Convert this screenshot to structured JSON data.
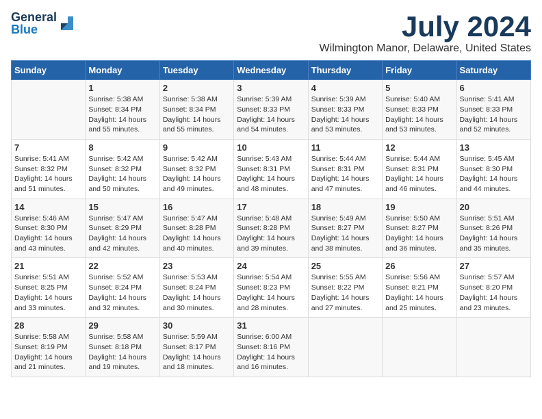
{
  "header": {
    "logo_general": "General",
    "logo_blue": "Blue",
    "month_year": "July 2024",
    "location": "Wilmington Manor, Delaware, United States"
  },
  "days_of_week": [
    "Sunday",
    "Monday",
    "Tuesday",
    "Wednesday",
    "Thursday",
    "Friday",
    "Saturday"
  ],
  "weeks": [
    [
      {
        "day": "",
        "content": ""
      },
      {
        "day": "1",
        "content": "Sunrise: 5:38 AM\nSunset: 8:34 PM\nDaylight: 14 hours\nand 55 minutes."
      },
      {
        "day": "2",
        "content": "Sunrise: 5:38 AM\nSunset: 8:34 PM\nDaylight: 14 hours\nand 55 minutes."
      },
      {
        "day": "3",
        "content": "Sunrise: 5:39 AM\nSunset: 8:33 PM\nDaylight: 14 hours\nand 54 minutes."
      },
      {
        "day": "4",
        "content": "Sunrise: 5:39 AM\nSunset: 8:33 PM\nDaylight: 14 hours\nand 53 minutes."
      },
      {
        "day": "5",
        "content": "Sunrise: 5:40 AM\nSunset: 8:33 PM\nDaylight: 14 hours\nand 53 minutes."
      },
      {
        "day": "6",
        "content": "Sunrise: 5:41 AM\nSunset: 8:33 PM\nDaylight: 14 hours\nand 52 minutes."
      }
    ],
    [
      {
        "day": "7",
        "content": "Sunrise: 5:41 AM\nSunset: 8:32 PM\nDaylight: 14 hours\nand 51 minutes."
      },
      {
        "day": "8",
        "content": "Sunrise: 5:42 AM\nSunset: 8:32 PM\nDaylight: 14 hours\nand 50 minutes."
      },
      {
        "day": "9",
        "content": "Sunrise: 5:42 AM\nSunset: 8:32 PM\nDaylight: 14 hours\nand 49 minutes."
      },
      {
        "day": "10",
        "content": "Sunrise: 5:43 AM\nSunset: 8:31 PM\nDaylight: 14 hours\nand 48 minutes."
      },
      {
        "day": "11",
        "content": "Sunrise: 5:44 AM\nSunset: 8:31 PM\nDaylight: 14 hours\nand 47 minutes."
      },
      {
        "day": "12",
        "content": "Sunrise: 5:44 AM\nSunset: 8:31 PM\nDaylight: 14 hours\nand 46 minutes."
      },
      {
        "day": "13",
        "content": "Sunrise: 5:45 AM\nSunset: 8:30 PM\nDaylight: 14 hours\nand 44 minutes."
      }
    ],
    [
      {
        "day": "14",
        "content": "Sunrise: 5:46 AM\nSunset: 8:30 PM\nDaylight: 14 hours\nand 43 minutes."
      },
      {
        "day": "15",
        "content": "Sunrise: 5:47 AM\nSunset: 8:29 PM\nDaylight: 14 hours\nand 42 minutes."
      },
      {
        "day": "16",
        "content": "Sunrise: 5:47 AM\nSunset: 8:28 PM\nDaylight: 14 hours\nand 40 minutes."
      },
      {
        "day": "17",
        "content": "Sunrise: 5:48 AM\nSunset: 8:28 PM\nDaylight: 14 hours\nand 39 minutes."
      },
      {
        "day": "18",
        "content": "Sunrise: 5:49 AM\nSunset: 8:27 PM\nDaylight: 14 hours\nand 38 minutes."
      },
      {
        "day": "19",
        "content": "Sunrise: 5:50 AM\nSunset: 8:27 PM\nDaylight: 14 hours\nand 36 minutes."
      },
      {
        "day": "20",
        "content": "Sunrise: 5:51 AM\nSunset: 8:26 PM\nDaylight: 14 hours\nand 35 minutes."
      }
    ],
    [
      {
        "day": "21",
        "content": "Sunrise: 5:51 AM\nSunset: 8:25 PM\nDaylight: 14 hours\nand 33 minutes."
      },
      {
        "day": "22",
        "content": "Sunrise: 5:52 AM\nSunset: 8:24 PM\nDaylight: 14 hours\nand 32 minutes."
      },
      {
        "day": "23",
        "content": "Sunrise: 5:53 AM\nSunset: 8:24 PM\nDaylight: 14 hours\nand 30 minutes."
      },
      {
        "day": "24",
        "content": "Sunrise: 5:54 AM\nSunset: 8:23 PM\nDaylight: 14 hours\nand 28 minutes."
      },
      {
        "day": "25",
        "content": "Sunrise: 5:55 AM\nSunset: 8:22 PM\nDaylight: 14 hours\nand 27 minutes."
      },
      {
        "day": "26",
        "content": "Sunrise: 5:56 AM\nSunset: 8:21 PM\nDaylight: 14 hours\nand 25 minutes."
      },
      {
        "day": "27",
        "content": "Sunrise: 5:57 AM\nSunset: 8:20 PM\nDaylight: 14 hours\nand 23 minutes."
      }
    ],
    [
      {
        "day": "28",
        "content": "Sunrise: 5:58 AM\nSunset: 8:19 PM\nDaylight: 14 hours\nand 21 minutes."
      },
      {
        "day": "29",
        "content": "Sunrise: 5:58 AM\nSunset: 8:18 PM\nDaylight: 14 hours\nand 19 minutes."
      },
      {
        "day": "30",
        "content": "Sunrise: 5:59 AM\nSunset: 8:17 PM\nDaylight: 14 hours\nand 18 minutes."
      },
      {
        "day": "31",
        "content": "Sunrise: 6:00 AM\nSunset: 8:16 PM\nDaylight: 14 hours\nand 16 minutes."
      },
      {
        "day": "",
        "content": ""
      },
      {
        "day": "",
        "content": ""
      },
      {
        "day": "",
        "content": ""
      }
    ]
  ]
}
